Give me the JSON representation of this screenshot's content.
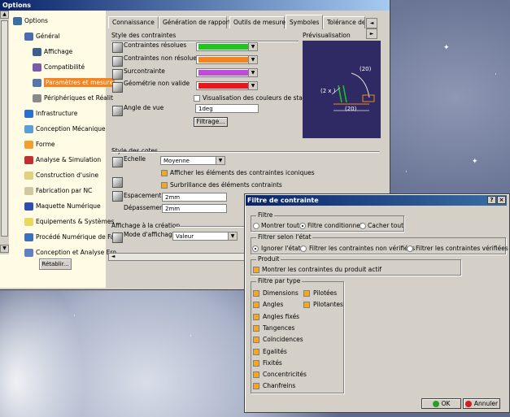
{
  "window": {
    "title": "Options"
  },
  "tree": {
    "items": [
      {
        "label": "Options"
      },
      {
        "label": "Général"
      },
      {
        "label": "Affichage"
      },
      {
        "label": "Compatibilité"
      },
      {
        "label": "Paramètres et mesure"
      },
      {
        "label": "Périphériques et Réalit"
      },
      {
        "label": "Infrastructure"
      },
      {
        "label": "Conception Mécanique"
      },
      {
        "label": "Forme"
      },
      {
        "label": "Analyse & Simulation"
      },
      {
        "label": "Construction d'usine"
      },
      {
        "label": "Fabrication par NC"
      },
      {
        "label": "Maquette Numérique"
      },
      {
        "label": "Equipements & Systèmes"
      },
      {
        "label": "Procédé Numérique de Fal"
      },
      {
        "label": "Conception et Analyse Ero"
      }
    ],
    "reset_label": "Rétablir..."
  },
  "tabs": [
    "Connaissance",
    "Génération de rapport",
    "Outils de mesure",
    "Symboles",
    "Tolérance des"
  ],
  "constraints_style": {
    "title": "Style des contraintes",
    "rows": [
      {
        "label": "Contraintes résolues",
        "color": "#22c51f"
      },
      {
        "label": "Contraintes non résolues",
        "color": "#f5841f"
      },
      {
        "label": "Surcontrainte",
        "color": "#c04bd8"
      },
      {
        "label": "Géométrie non valide",
        "color": "#e8171b"
      }
    ],
    "status_colors_label": "Visualisation des couleurs de status",
    "view_angle_label": "Angle de vue",
    "view_angle_value": "1deg",
    "filter_button": "Filtrage..."
  },
  "preview": {
    "title": "Prévisualisation",
    "labels": [
      "(20)",
      "(2 x )",
      "(20)"
    ]
  },
  "dimension_style": {
    "title": "Style des cotes",
    "scale_label": "Echelle",
    "scale_value": "Moyenne",
    "iconic_label": "Afficher les éléments des contraintes iconiques",
    "highlight_label": "Surbrillance des éléments contraints",
    "spacing_label": "Espacement",
    "spacing_value": "2mm",
    "overflow_label": "Dépassement",
    "overflow_value": "2mm"
  },
  "creation_display": {
    "title": "Affichage à la création",
    "mode_label": "Mode d'affichage",
    "mode_value": "Valeur"
  },
  "dialog": {
    "title": "Filtre de contrainte",
    "filter": {
      "title": "Filtre",
      "options": [
        "Montrer tout",
        "Filtre conditionnel",
        "Cacher tout"
      ],
      "selected": "Filtre conditionnel"
    },
    "state_filter": {
      "title": "Filtrer selon l'état",
      "options": [
        "Ignorer l'état",
        "Filtrer les contraintes non vérifiées",
        "Filtrer les contraintes vérifiées"
      ],
      "selected": "Ignorer l'état"
    },
    "product": {
      "title": "Produit",
      "option": "Montrer les contraintes du produit actif"
    },
    "type_filter": {
      "title": "Filtre par type",
      "col1": [
        "Dimensions",
        "Angles",
        "Angles fixés",
        "Tangences",
        "Coïncidences",
        "Egalités",
        "Fixités",
        "Concentricités",
        "Chanfreins"
      ],
      "col2": [
        "Pilotées",
        "Pilotantes"
      ]
    },
    "ok_label": "OK",
    "cancel_label": "Annuler"
  },
  "colors": {
    "accent": "#f5841f",
    "titlebar": "#0a246a",
    "tree_bg": "#fffbe5"
  }
}
